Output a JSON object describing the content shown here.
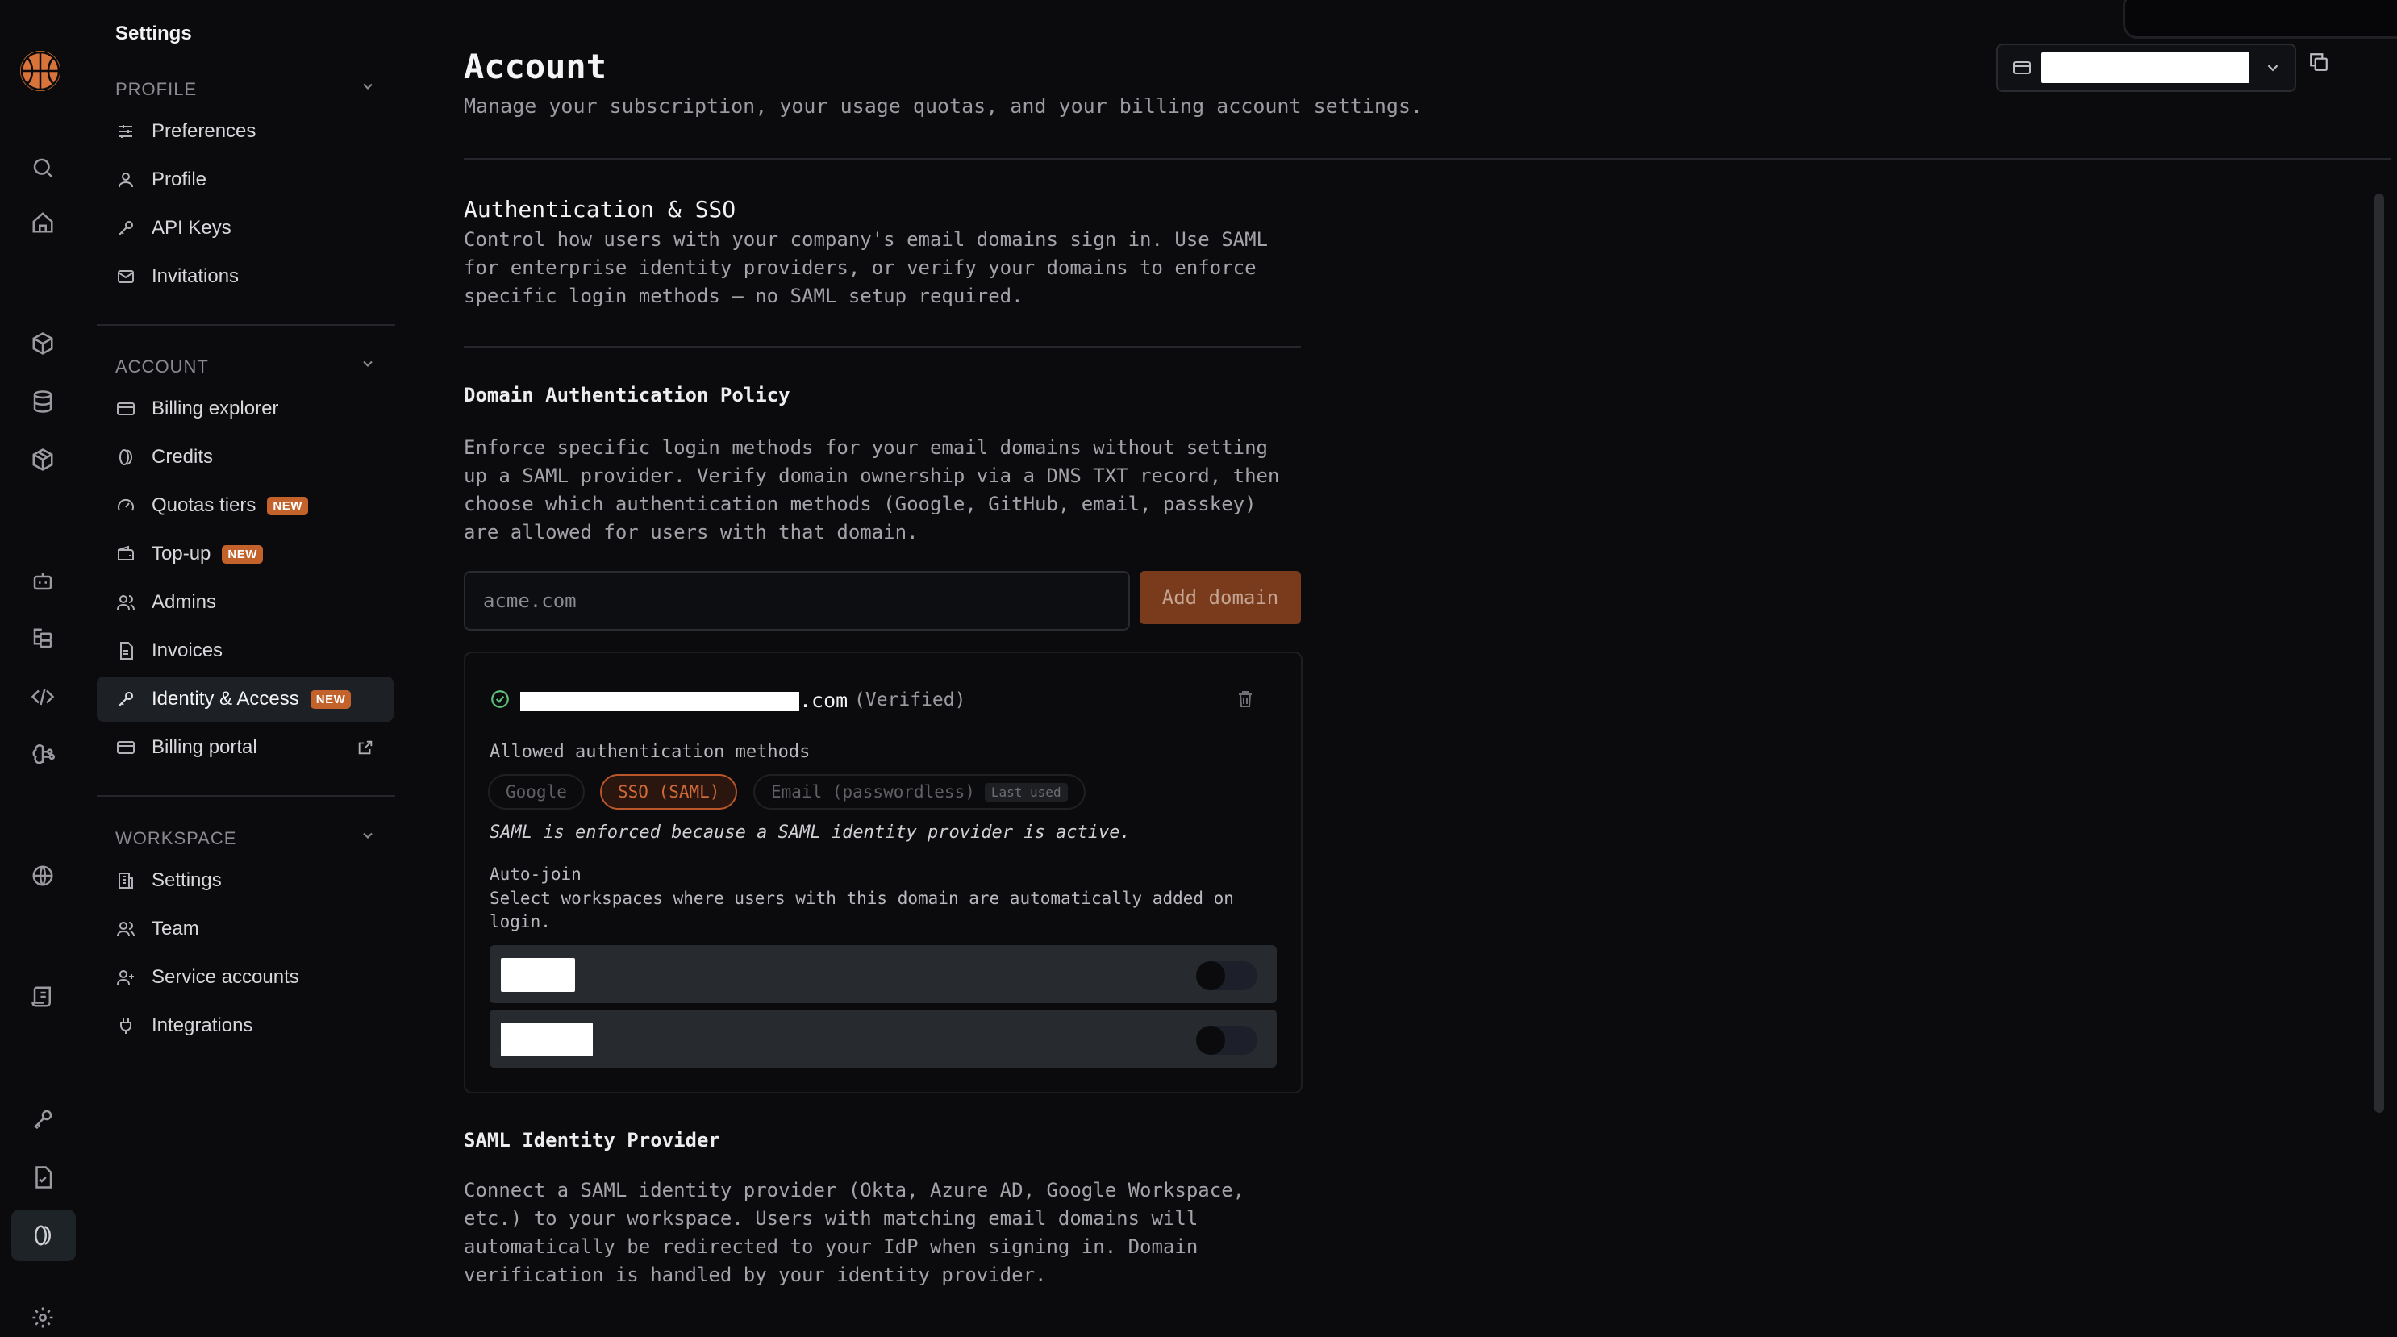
{
  "sidebar": {
    "title": "Settings",
    "sections": {
      "profile": {
        "label": "PROFILE",
        "items": [
          {
            "label": "Preferences",
            "icon": "sliders-icon"
          },
          {
            "label": "Profile",
            "icon": "user-icon"
          },
          {
            "label": "API Keys",
            "icon": "key-icon"
          },
          {
            "label": "Invitations",
            "icon": "mail-icon"
          }
        ]
      },
      "account": {
        "label": "ACCOUNT",
        "items": [
          {
            "label": "Billing explorer",
            "icon": "credit-card-icon"
          },
          {
            "label": "Credits",
            "icon": "coins-icon"
          },
          {
            "label": "Quotas tiers",
            "icon": "gauge-icon",
            "badge": "NEW"
          },
          {
            "label": "Top-up",
            "icon": "wallet-icon",
            "badge": "NEW"
          },
          {
            "label": "Admins",
            "icon": "users-icon"
          },
          {
            "label": "Invoices",
            "icon": "file-text-icon"
          },
          {
            "label": "Identity & Access",
            "icon": "key-icon",
            "badge": "NEW",
            "active": true
          },
          {
            "label": "Billing portal",
            "icon": "credit-card-icon",
            "external": true
          }
        ]
      },
      "workspace": {
        "label": "WORKSPACE",
        "items": [
          {
            "label": "Settings",
            "icon": "building-icon"
          },
          {
            "label": "Team",
            "icon": "users-icon"
          },
          {
            "label": "Service accounts",
            "icon": "user-plus-icon"
          },
          {
            "label": "Integrations",
            "icon": "plug-icon"
          }
        ]
      }
    }
  },
  "header": {
    "title": "Account",
    "subtitle": "Manage your subscription, your usage quotas, and your billing account settings."
  },
  "auth": {
    "title": "Authentication & SSO",
    "description": "Control how users with your company's email domains sign in. Use SAML for enterprise identity providers, or verify your domains to enforce specific login methods — no SAML setup required."
  },
  "domain_policy": {
    "title": "Domain Authentication Policy",
    "description": "Enforce specific login methods for your email domains without setting up a SAML provider. Verify domain ownership via a DNS TXT record, then choose which authentication methods (Google, GitHub, email, passkey) are allowed for users with that domain.",
    "input_placeholder": "acme.com",
    "add_button": "Add domain"
  },
  "domain_card": {
    "domain_suffix": ".com",
    "status": "(Verified)",
    "allowed_label": "Allowed authentication methods",
    "methods": [
      {
        "label": "Google",
        "selected": false
      },
      {
        "label": "SSO (SAML)",
        "selected": true
      },
      {
        "label": "Email (passwordless)",
        "selected": false,
        "tag": "Last used"
      }
    ],
    "saml_note": "SAML is enforced because a SAML identity provider is active.",
    "autojoin_title": "Auto-join",
    "autojoin_desc": "Select workspaces where users with this domain are automatically added on login.",
    "workspaces": [
      {
        "enabled": false
      },
      {
        "enabled": false
      }
    ]
  },
  "saml_idp": {
    "title": "SAML Identity Provider",
    "description": "Connect a SAML identity provider (Okta, Azure AD, Google Workspace, etc.) to your workspace. Users with matching email domains will automatically be redirected to your IdP when signing in. Domain verification is handled by your identity provider."
  },
  "colors": {
    "accent": "#c4622b",
    "background": "#0b0b0d",
    "verified": "#5ec27c"
  }
}
